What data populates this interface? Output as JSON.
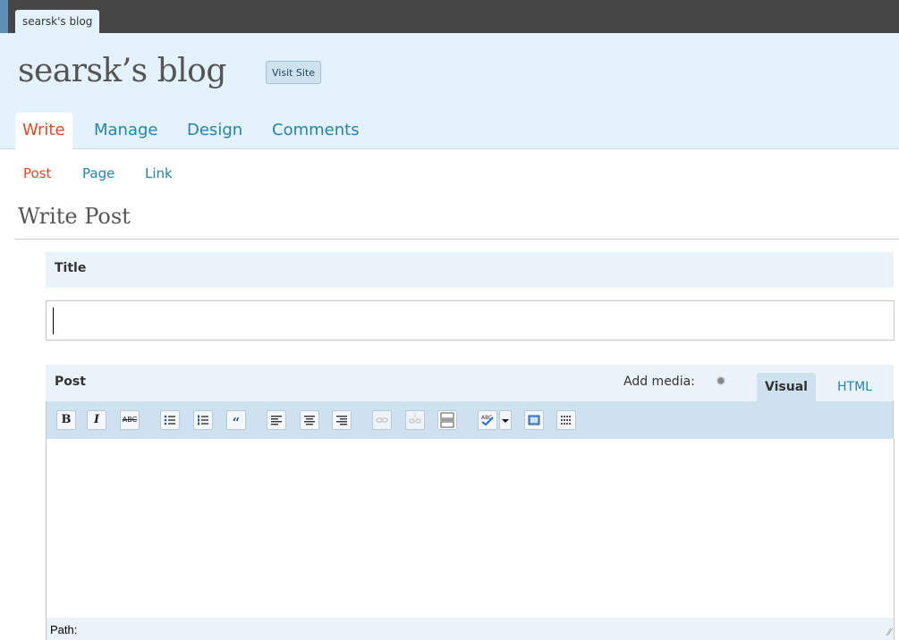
{
  "browser_tab": {
    "label": "searsk's blog"
  },
  "header": {
    "blog_title": "searsk’s blog",
    "visit_site": "Visit Site"
  },
  "main_nav": [
    {
      "label": "Write",
      "active": true
    },
    {
      "label": "Manage",
      "active": false
    },
    {
      "label": "Design",
      "active": false
    },
    {
      "label": "Comments",
      "active": false
    }
  ],
  "sub_nav": [
    {
      "label": "Post",
      "active": true
    },
    {
      "label": "Page",
      "active": false
    },
    {
      "label": "Link",
      "active": false
    }
  ],
  "page": {
    "heading": "Write Post"
  },
  "title_section": {
    "label": "Title",
    "value": ""
  },
  "post_section": {
    "label": "Post",
    "add_media": "Add media:",
    "add_media_icon": "gear-icon",
    "tab_visual": "Visual",
    "tab_html": "HTML",
    "toolbar": {
      "bold": "B",
      "italic": "I",
      "strikethrough": "ABC",
      "blockquote": "“",
      "buttons": [
        "bold",
        "italic",
        "strikethrough",
        "bullet-list",
        "numbered-list",
        "blockquote",
        "align-left",
        "align-center",
        "align-right",
        "insert-link",
        "unlink",
        "insert-more",
        "spellcheck",
        "spellcheck-dropdown",
        "fullscreen",
        "kitchen-sink"
      ]
    },
    "path_label": "Path:"
  },
  "colors": {
    "accent_active": "#d54e21",
    "link": "#2583ad",
    "header_bg": "#e4f2fd",
    "topbar_bg": "#464646"
  }
}
